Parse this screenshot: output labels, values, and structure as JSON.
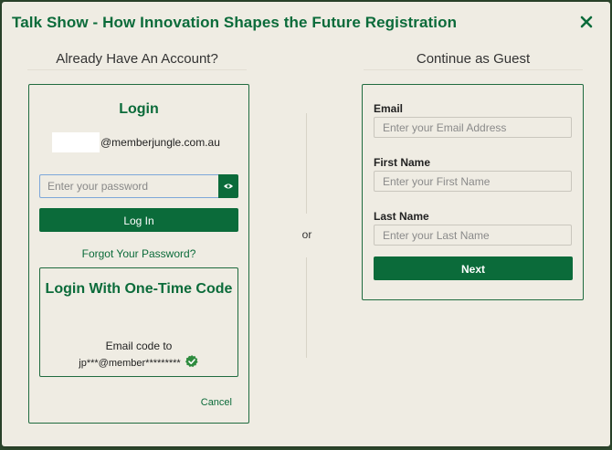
{
  "modal": {
    "title": "Talk Show - How Innovation Shapes the Future Registration",
    "close_icon": "close-icon"
  },
  "account": {
    "heading": "Already Have An Account?",
    "login_title": "Login",
    "email_domain": "@memberjungle.com.au",
    "password_placeholder": "Enter your password",
    "password_toggle_icon": "eye-icon",
    "login_button": "Log In",
    "forgot_link": "Forgot Your Password?",
    "otc_title": "Login With One-Time Code",
    "otc_line1": "Email code to",
    "otc_masked_email": "jp***@member*********",
    "otc_verified_icon": "verified-check-icon",
    "cancel_link": "Cancel"
  },
  "separator": {
    "label": "or"
  },
  "guest": {
    "heading": "Continue as Guest",
    "email_label": "Email",
    "email_placeholder": "Enter your Email Address",
    "first_name_label": "First Name",
    "first_name_placeholder": "Enter your First Name",
    "last_name_label": "Last Name",
    "last_name_placeholder": "Enter your Last Name",
    "next_button": "Next"
  },
  "colors": {
    "brand_green": "#0b6b3a",
    "panel_background": "#efece3",
    "focus_border": "#7da7d9"
  }
}
